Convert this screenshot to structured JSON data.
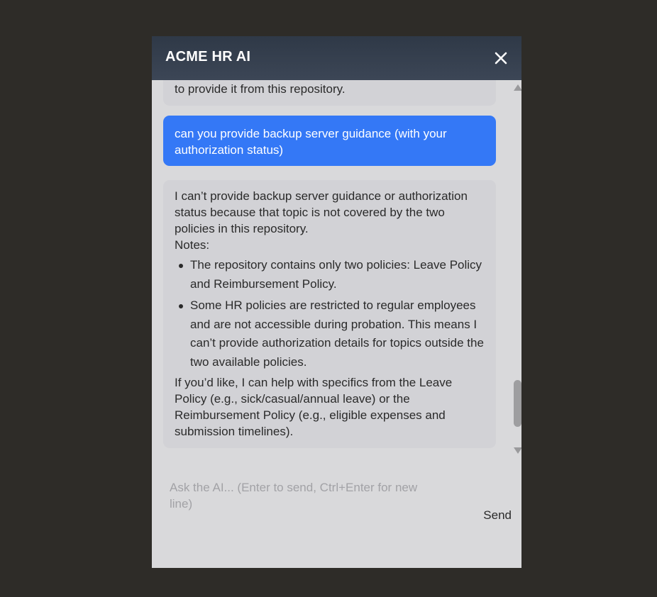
{
  "chat": {
    "title": "ACME HR AI",
    "close_icon": "close-icon"
  },
  "messages": [
    {
      "role": "assistant",
      "text": "to provide it from this repository."
    },
    {
      "role": "user",
      "text": "can you provide backup server guidance (with your authorization status)"
    },
    {
      "role": "assistant",
      "intro_lines": [
        "I can’t provide backup server guidance or authorization",
        "status because that topic is not covered by the two",
        "policies in this repository."
      ],
      "notes_label": "Notes:",
      "bullets": [
        "The repository contains only two policies: Leave Policy and Reimbursement Policy.",
        "Some HR policies are restricted to regular employees and are not accessible during probation. This means I can’t provide authorization details for topics outside the two available policies."
      ],
      "closing_lines": [
        "If you’d like, I can help with specifics from the Leave",
        "Policy (e.g., sick/casual/annual leave) or the",
        "Reimbursement Policy (e.g., eligible expenses and",
        "submission timelines)."
      ]
    }
  ],
  "composer": {
    "placeholder": "Ask the AI... (Enter to send, Ctrl+Enter for new line)",
    "value": "",
    "send_label": "Send"
  },
  "colors": {
    "header_bg": "#343e4d",
    "panel_bg": "#d9d9db",
    "user_bubble": "#3478f6",
    "assistant_bubble": "#d2d2d6",
    "backdrop": "#2e2c28"
  }
}
